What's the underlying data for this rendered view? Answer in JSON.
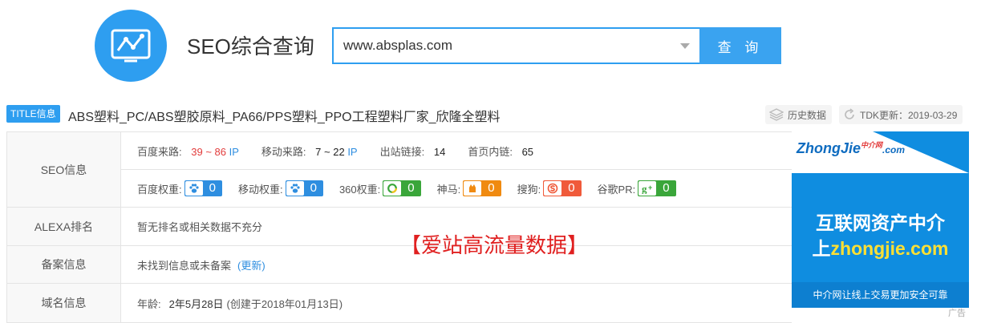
{
  "header": {
    "site_title": "SEO综合查询",
    "search_value": "www.absplas.com",
    "search_button": "查 询"
  },
  "title_row": {
    "badge": "TITLE信息",
    "text": "ABS塑料_PC/ABS塑胶原料_PA66/PPS塑料_PPO工程塑料厂家_欣隆全塑料",
    "history_label": "历史数据",
    "tdk_label": "TDK更新：2019-03-29"
  },
  "seo": {
    "label": "SEO信息",
    "baidu_traffic_label": "百度来路:",
    "baidu_traffic_value": "39 ~ 86",
    "baidu_traffic_unit": "IP",
    "mobile_traffic_label": "移动来路:",
    "mobile_traffic_value": "7 ~ 22",
    "mobile_traffic_unit": "IP",
    "outlinks_label": "出站链接:",
    "outlinks_value": "14",
    "homepage_links_label": "首页内链:",
    "homepage_links_value": "65",
    "weights": [
      {
        "label": "百度权重:",
        "value": "0",
        "color": "#2e8ee0"
      },
      {
        "label": "移动权重:",
        "value": "0",
        "color": "#2e8ee0"
      },
      {
        "label": "360权重:",
        "value": "0",
        "color": "#3aa63a"
      },
      {
        "label": "神马:",
        "value": "0",
        "color": "#f08a10"
      },
      {
        "label": "搜狗:",
        "value": "0",
        "color": "#f05a3a"
      },
      {
        "label": "谷歌PR:",
        "value": "0",
        "color": "#3aa63a"
      }
    ]
  },
  "alexa": {
    "label": "ALEXA排名",
    "value": "暂无排名或相关数据不充分"
  },
  "beian": {
    "label": "备案信息",
    "value": "未找到信息或未备案",
    "update_link": "(更新)"
  },
  "domain": {
    "label": "域名信息",
    "age_label": "年龄:",
    "age_value": "2年5月28日",
    "created": "(创建于2018年01月13日)"
  },
  "watermark": "【爱站高流量数据】",
  "ad": {
    "logo_text": "ZhongJie",
    "logo_small": "中介网",
    "logo_suffix": ".com",
    "line1": "互联网资产中介",
    "line2_prefix": "上",
    "line2_domain": "zhongjie.com",
    "bottom_text": "中介网让线上交易更加安全可靠",
    "tag": "广告"
  }
}
